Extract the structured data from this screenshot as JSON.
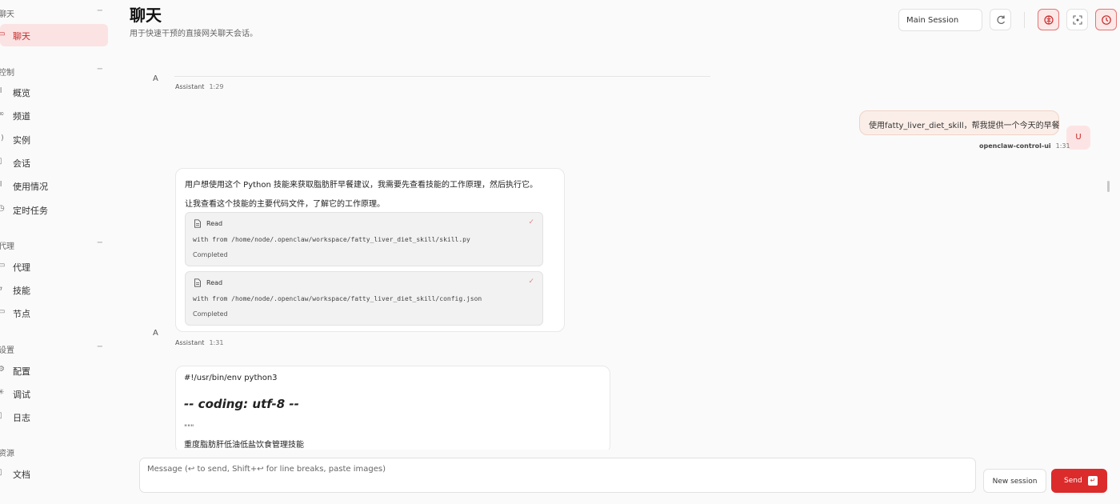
{
  "sidebar": {
    "sections": [
      {
        "label": "聊天",
        "toggle": "−",
        "items": [
          {
            "label": "聊天",
            "icon": "chat-icon",
            "active": true
          }
        ]
      },
      {
        "label": "控制",
        "toggle": "−",
        "items": [
          {
            "label": "概览",
            "icon": "bar-chart-icon"
          },
          {
            "label": "频道",
            "icon": "link-icon"
          },
          {
            "label": "实例",
            "icon": "broadcast-icon"
          },
          {
            "label": "会话",
            "icon": "file-icon"
          },
          {
            "label": "使用情况",
            "icon": "usage-icon"
          },
          {
            "label": "定时任务",
            "icon": "clock-icon"
          }
        ]
      },
      {
        "label": "代理",
        "toggle": "−",
        "items": [
          {
            "label": "代理",
            "icon": "folder-icon"
          },
          {
            "label": "技能",
            "icon": "lightning-icon"
          },
          {
            "label": "节点",
            "icon": "monitor-icon"
          }
        ]
      },
      {
        "label": "设置",
        "toggle": "−",
        "items": [
          {
            "label": "配置",
            "icon": "gear-icon"
          },
          {
            "label": "调试",
            "icon": "bug-icon"
          },
          {
            "label": "日志",
            "icon": "log-icon"
          }
        ]
      },
      {
        "label": "资源",
        "toggle": "",
        "items": [
          {
            "label": "文档",
            "icon": "book-icon"
          }
        ]
      }
    ]
  },
  "header": {
    "title": "聊天",
    "subtitle": "用于快速干预的直接网关聊天会话。",
    "session_select": "Main Session"
  },
  "chat": {
    "msg1": {
      "avatar": "A",
      "sender": "Assistant",
      "time": "1:29"
    },
    "user_msg": {
      "text": "使用fatty_liver_diet_skill，帮我提供一个今天的早餐",
      "avatar": "U",
      "sender": "openclaw-control-ui",
      "time": "1:31"
    },
    "msg2": {
      "avatar": "A",
      "sender": "Assistant",
      "time": "1:31",
      "p1": "用户想使用这个 Python 技能来获取脂肪肝早餐建议，我需要先查看技能的工作原理，然后执行它。",
      "p2": "让我查看这个技能的主要代码文件，了解它的工作原理。",
      "tools": [
        {
          "name": "Read",
          "cmd": "with from /home/node/.openclaw/workspace/fatty_liver_diet_skill/skill.py",
          "status": "Completed",
          "check": "✓"
        },
        {
          "name": "Read",
          "cmd": "with from /home/node/.openclaw/workspace/fatty_liver_diet_skill/config.json",
          "status": "Completed",
          "check": "✓"
        }
      ]
    },
    "msg3": {
      "avatar": "A",
      "line1": "#!/usr/bin/env python3",
      "heading": "-- coding: utf-8 --",
      "quote": "\"\"\"",
      "line2": "重度脂肪肝低油低盐饮食管理技能"
    }
  },
  "composer": {
    "placeholder": "Message (↩ to send, Shift+↩ for line breaks, paste images)",
    "new_session": "New session",
    "send": "Send",
    "send_kbd": "↵"
  }
}
